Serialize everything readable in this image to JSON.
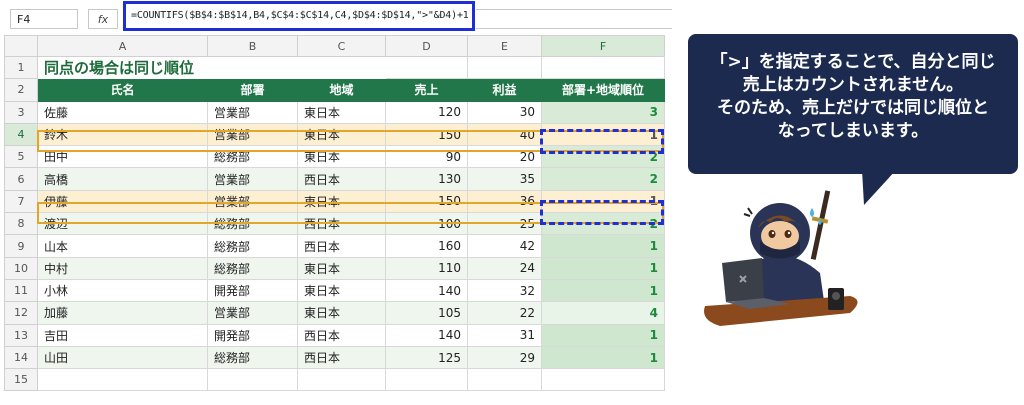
{
  "formula_bar": {
    "cell_ref": "F4",
    "fx_label": "fx",
    "formula": "=COUNTIFS($B$4:$B$14,B4,$C$4:$C$14,C4,$D$4:$D$14,\">\"&D4)+1"
  },
  "columns": [
    "A",
    "B",
    "C",
    "D",
    "E",
    "F"
  ],
  "row_numbers": [
    "1",
    "2",
    "3",
    "4",
    "5",
    "6",
    "7",
    "8",
    "9",
    "10",
    "11",
    "12",
    "13",
    "14",
    "15"
  ],
  "title": "同点の場合は同じ順位",
  "headers": [
    "氏名",
    "部署",
    "地域",
    "売上",
    "利益",
    "部署+地域順位"
  ],
  "rows": [
    {
      "name": "佐藤",
      "dept": "営業部",
      "region": "東日本",
      "sales": "120",
      "profit": "30",
      "rank": "3"
    },
    {
      "name": "鈴木",
      "dept": "営業部",
      "region": "東日本",
      "sales": "150",
      "profit": "40",
      "rank": "1"
    },
    {
      "name": "田中",
      "dept": "総務部",
      "region": "東日本",
      "sales": "90",
      "profit": "20",
      "rank": "2"
    },
    {
      "name": "高橋",
      "dept": "営業部",
      "region": "西日本",
      "sales": "130",
      "profit": "35",
      "rank": "2"
    },
    {
      "name": "伊藤",
      "dept": "営業部",
      "region": "東日本",
      "sales": "150",
      "profit": "36",
      "rank": "1"
    },
    {
      "name": "渡辺",
      "dept": "総務部",
      "region": "西日本",
      "sales": "100",
      "profit": "25",
      "rank": "2"
    },
    {
      "name": "山本",
      "dept": "総務部",
      "region": "西日本",
      "sales": "160",
      "profit": "42",
      "rank": "1"
    },
    {
      "name": "中村",
      "dept": "総務部",
      "region": "東日本",
      "sales": "110",
      "profit": "24",
      "rank": "1"
    },
    {
      "name": "小林",
      "dept": "開発部",
      "region": "東日本",
      "sales": "140",
      "profit": "32",
      "rank": "1"
    },
    {
      "name": "加藤",
      "dept": "営業部",
      "region": "東日本",
      "sales": "105",
      "profit": "22",
      "rank": "4"
    },
    {
      "name": "吉田",
      "dept": "開発部",
      "region": "西日本",
      "sales": "140",
      "profit": "31",
      "rank": "1"
    },
    {
      "name": "山田",
      "dept": "総務部",
      "region": "西日本",
      "sales": "125",
      "profit": "29",
      "rank": "1"
    }
  ],
  "callout": {
    "lines": [
      "「>」を指定することで、自分と同じ",
      "売上はカウントされません。",
      "そのため、売上だけでは同じ順位と",
      "なってしまいます。"
    ]
  },
  "colors": {
    "header_green": "#22774a",
    "highlight_border": "#e3a52a",
    "dash_blue": "#1f2fd6",
    "callout_bg": "#1b2a4e"
  }
}
